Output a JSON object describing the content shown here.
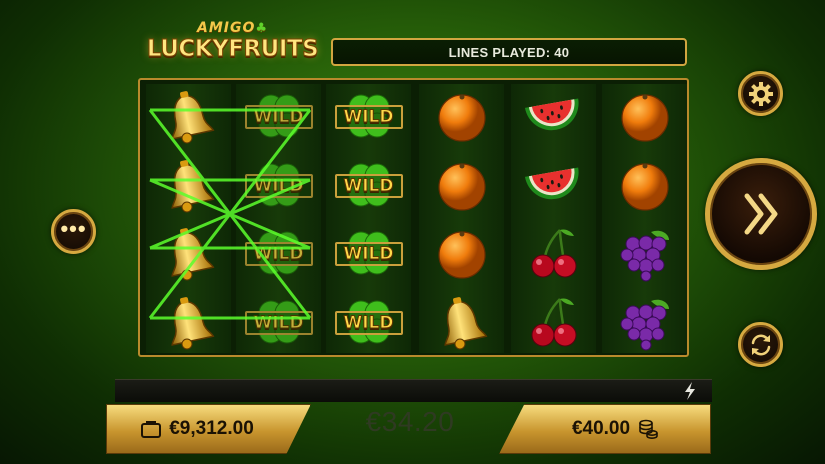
{
  "logo": {
    "top": "AMIGO",
    "main": "LUCKYFRUITS"
  },
  "lines_played": "LINES PLAYED: 40",
  "reels": [
    [
      "bell",
      "bell",
      "bell",
      "bell"
    ],
    [
      "wild",
      "wild",
      "wild",
      "wild"
    ],
    [
      "wild",
      "wild",
      "wild",
      "wild"
    ],
    [
      "orange",
      "orange",
      "orange",
      "bell"
    ],
    [
      "watermelon",
      "watermelon",
      "cherry",
      "cherry"
    ],
    [
      "orange",
      "orange",
      "grapes",
      "grapes"
    ]
  ],
  "wild_label": "WILD",
  "buttons": {
    "menu_icon": "more-dots-icon",
    "settings_icon": "gear-icon",
    "spin_icon": "double-chevron-right-icon",
    "autoplay_icon": "refresh-icon",
    "turbo_icon": "lightning-bolt-icon"
  },
  "balance": "€9,312.00",
  "win": "€34.20",
  "bet": "€40.00",
  "colors": {
    "accent_gold": "#d6a940",
    "background_green": "#2a6a0a",
    "payline_green": "#5cff2c"
  }
}
